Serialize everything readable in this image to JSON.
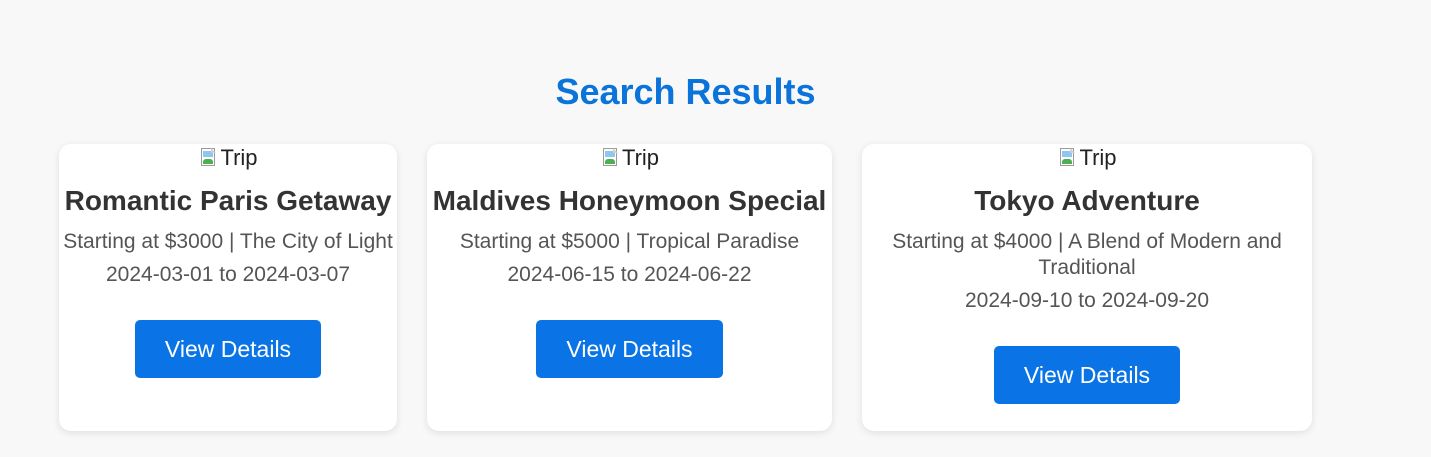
{
  "page": {
    "title": "Search Results"
  },
  "results": [
    {
      "image_alt": "Trip",
      "title": "Romantic Paris Getaway",
      "description": "Starting at $3000 | The City of Light",
      "dates": "2024-03-01 to 2024-03-07",
      "button_label": "View Details"
    },
    {
      "image_alt": "Trip",
      "title": "Maldives Honeymoon Special",
      "description": "Starting at $5000 | Tropical Paradise",
      "dates": "2024-06-15 to 2024-06-22",
      "button_label": "View Details"
    },
    {
      "image_alt": "Trip",
      "title": "Tokyo Adventure",
      "description": "Starting at $4000 | A Blend of Modern and Traditional",
      "dates": "2024-09-10 to 2024-09-20",
      "button_label": "View Details"
    }
  ],
  "colors": {
    "accent": "#0a74da",
    "button": "#0a74e6",
    "background": "#f8f8f8",
    "card": "#ffffff"
  },
  "icons": {
    "image": "broken-image-icon"
  }
}
